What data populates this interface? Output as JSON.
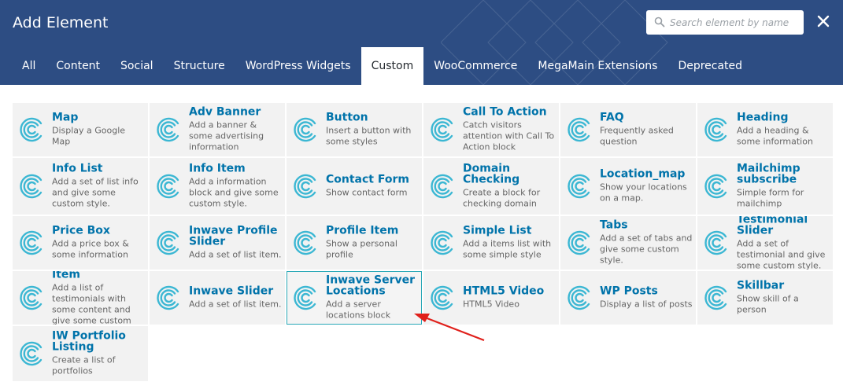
{
  "header": {
    "title": "Add Element",
    "search_placeholder": "Search element by name",
    "close_icon": "close-icon",
    "bg_color": "#2d4d83"
  },
  "tabs": [
    {
      "label": "All",
      "active": false
    },
    {
      "label": "Content",
      "active": false
    },
    {
      "label": "Social",
      "active": false
    },
    {
      "label": "Structure",
      "active": false
    },
    {
      "label": "WordPress Widgets",
      "active": false
    },
    {
      "label": "Custom",
      "active": true
    },
    {
      "label": "WooCommerce",
      "active": false
    },
    {
      "label": "MegaMain Extensions",
      "active": false
    },
    {
      "label": "Deprecated",
      "active": false
    }
  ],
  "elements": [
    {
      "name": "Map",
      "desc": "Display a Google Map"
    },
    {
      "name": "Adv Banner",
      "desc": "Add a banner & some advertising information"
    },
    {
      "name": "Button",
      "desc": "Insert a button with some styles"
    },
    {
      "name": "Call To Action",
      "desc": "Catch visitors attention with Call To Action block"
    },
    {
      "name": "FAQ",
      "desc": "Frequently asked question"
    },
    {
      "name": "Heading",
      "desc": "Add a heading & some information"
    },
    {
      "name": "Info List",
      "desc": "Add a set of list info and give some custom style."
    },
    {
      "name": "Info Item",
      "desc": "Add a information block and give some custom style."
    },
    {
      "name": "Contact Form",
      "desc": "Show contact form"
    },
    {
      "name": "Domain Checking",
      "desc": "Create a block for checking domain"
    },
    {
      "name": "Location_map",
      "desc": "Show your locations on a map."
    },
    {
      "name": "Mailchimp subscribe",
      "desc": "Simple form for mailchimp"
    },
    {
      "name": "Price Box",
      "desc": "Add a price box & some information"
    },
    {
      "name": "Inwave Profile Slider",
      "desc": "Add a set of list item."
    },
    {
      "name": "Profile Item",
      "desc": "Show a personal profile"
    },
    {
      "name": "Simple List",
      "desc": "Add a items list with some simple style"
    },
    {
      "name": "Tabs",
      "desc": "Add a set of tabs and give some custom style."
    },
    {
      "name": "Testimonial Slider",
      "desc": "Add a set of testimonial and give some custom style."
    },
    {
      "name": "Testimonial Item",
      "desc": "Add a list of testimonials with some content and give some custom style."
    },
    {
      "name": "Inwave Slider",
      "desc": "Add a set of list item."
    },
    {
      "name": "Inwave Server Locations",
      "desc": "Add a server locations block",
      "highlight": true
    },
    {
      "name": "HTML5 Video",
      "desc": "HTML5 Video"
    },
    {
      "name": "WP Posts",
      "desc": "Display a list of posts"
    },
    {
      "name": "Skillbar",
      "desc": "Show skill of a person"
    },
    {
      "name": "IW Portfolio Listing",
      "desc": "Create a list of portfolios"
    }
  ],
  "element_icon": "inwave-swirl-icon",
  "colors": {
    "accent": "#0073aa",
    "icon": "#3bb7d3",
    "highlight_border": "#2aa8b7",
    "arrow": "#e0201b"
  }
}
